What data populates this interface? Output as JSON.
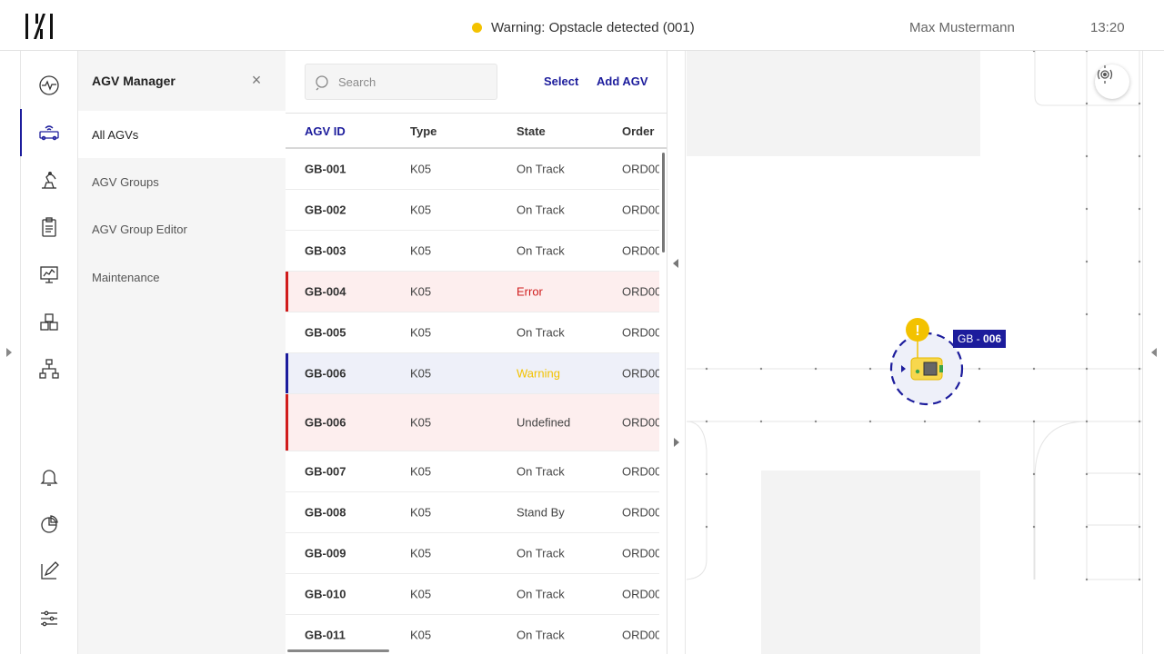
{
  "topbar": {
    "logo": "logo-mark",
    "warning": "Warning: Opstacle detected (001)",
    "warning_color": "#f3c200",
    "user": "Max Mustermann",
    "time": "13:20"
  },
  "rail": {
    "items": [
      {
        "icon": "activity-icon"
      },
      {
        "icon": "agv-icon",
        "active": true
      },
      {
        "icon": "robot-arm-icon"
      },
      {
        "icon": "clipboard-icon"
      },
      {
        "icon": "monitor-chart-icon"
      },
      {
        "icon": "boxes-icon"
      },
      {
        "icon": "hierarchy-icon"
      },
      {
        "icon": "bell-icon"
      },
      {
        "icon": "pie-chart-icon"
      },
      {
        "icon": "edit-icon"
      },
      {
        "icon": "sliders-icon"
      }
    ]
  },
  "menu": {
    "title": "AGV Manager",
    "close": "×",
    "items": [
      {
        "label": "All AGVs"
      },
      {
        "label": "AGV Groups"
      },
      {
        "label": "AGV Group Editor"
      },
      {
        "label": "Maintenance"
      }
    ]
  },
  "table": {
    "search_placeholder": "Search",
    "select_label": "Select",
    "add_label": "Add AGV",
    "columns": [
      "AGV ID",
      "Type",
      "State",
      "Order"
    ],
    "rows": [
      {
        "id": "GB-001",
        "type": "K05",
        "state": "On Track",
        "order": "ORD00"
      },
      {
        "id": "GB-002",
        "type": "K05",
        "state": "On Track",
        "order": "ORD00"
      },
      {
        "id": "GB-003",
        "type": "K05",
        "state": "On Track",
        "order": "ORD00"
      },
      {
        "id": "GB-004",
        "type": "K05",
        "state": "Error",
        "order": "ORD00"
      },
      {
        "id": "GB-005",
        "type": "K05",
        "state": "On Track",
        "order": "ORD00"
      },
      {
        "id": "GB-006",
        "type": "K05",
        "state": "Warning",
        "order": "ORD00"
      },
      {
        "id": "GB-006",
        "type": "K05",
        "state": "Undefined",
        "order": "ORD00"
      },
      {
        "id": "GB-007",
        "type": "K05",
        "state": "On Track",
        "order": "ORD00"
      },
      {
        "id": "GB-008",
        "type": "K05",
        "state": "Stand By",
        "order": "ORD00"
      },
      {
        "id": "GB-009",
        "type": "K05",
        "state": "On Track",
        "order": "ORD00"
      },
      {
        "id": "GB-010",
        "type": "K05",
        "state": "On Track",
        "order": "ORD00"
      },
      {
        "id": "GB-011",
        "type": "K05",
        "state": "On Track",
        "order": "ORD00"
      }
    ]
  },
  "map": {
    "agv_label_prefix": "GB - ",
    "agv_label_number": "006",
    "warning_mark": "!",
    "colors": {
      "accent": "#1c1c9c",
      "warning": "#f3c200",
      "error": "#d01c1c"
    }
  }
}
